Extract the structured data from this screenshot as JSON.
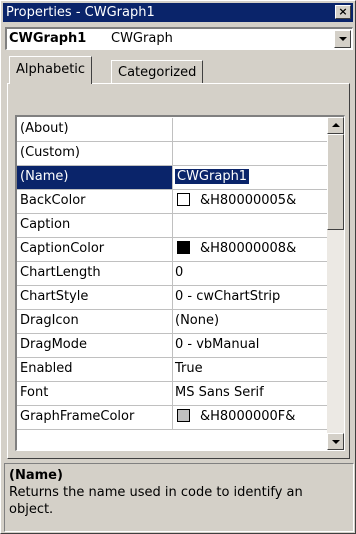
{
  "window": {
    "title": "Properties - CWGraph1",
    "close_glyph": "×"
  },
  "object_combo": {
    "name": "CWGraph1",
    "type": "CWGraph"
  },
  "tabs": [
    {
      "label": "Alphabetic",
      "active": true
    },
    {
      "label": "Categorized",
      "active": false
    }
  ],
  "properties": [
    {
      "name": "(About)",
      "value": ""
    },
    {
      "name": "(Custom)",
      "value": ""
    },
    {
      "name": "(Name)",
      "value": "CWGraph1",
      "selected": true
    },
    {
      "name": "BackColor",
      "value": "&H80000005&",
      "swatch": "#ffffff"
    },
    {
      "name": "Caption",
      "value": ""
    },
    {
      "name": "CaptionColor",
      "value": "&H80000008&",
      "swatch": "#000000"
    },
    {
      "name": "ChartLength",
      "value": "0"
    },
    {
      "name": "ChartStyle",
      "value": "0 - cwChartStrip"
    },
    {
      "name": "DragIcon",
      "value": "(None)"
    },
    {
      "name": "DragMode",
      "value": "0 - vbManual"
    },
    {
      "name": "Enabled",
      "value": "True"
    },
    {
      "name": "Font",
      "value": "MS Sans Serif"
    },
    {
      "name": "GraphFrameColor",
      "value": "&H8000000F&",
      "swatch": "#c0c0c0"
    }
  ],
  "scrollbar": {
    "position_fraction": 0.0,
    "visible_fraction": 0.32
  },
  "description": {
    "title": "(Name)",
    "text": "Returns the name used in code to identify an object."
  },
  "colors": {
    "selection": "#0a246a",
    "face": "#d4d0c8"
  }
}
